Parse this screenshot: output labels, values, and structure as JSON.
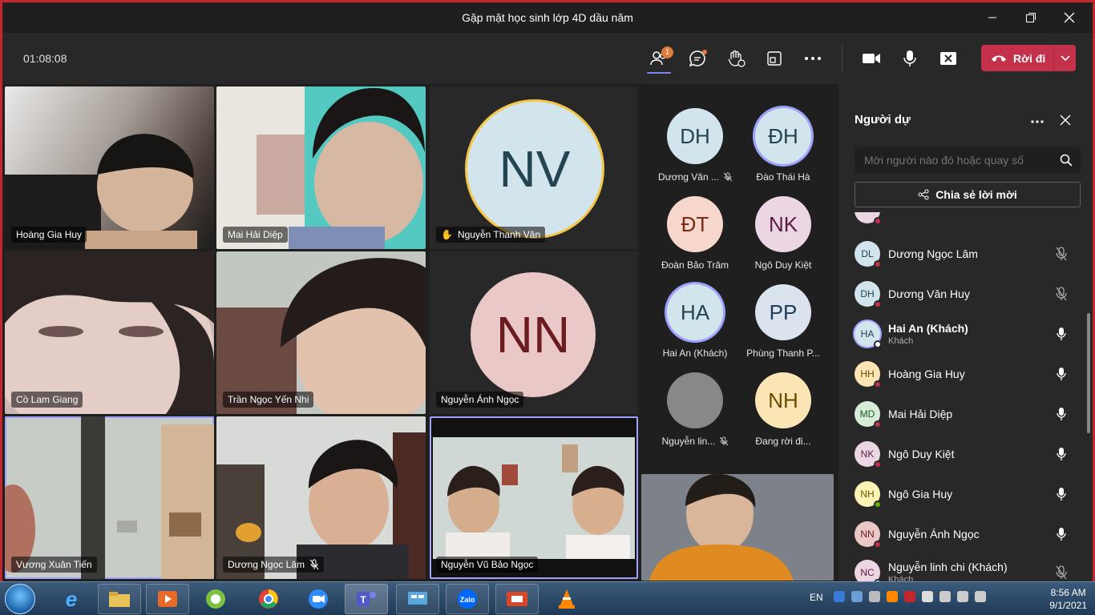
{
  "window": {
    "title": "Gặp mặt học sinh lớp 4D dầu năm"
  },
  "toolbar": {
    "timer": "01:08:08",
    "participants_badge": "1",
    "leave_label": "Rời đi"
  },
  "colors": {
    "accent": "#7f85f5",
    "leave": "#c4314b",
    "border": "#c4262e"
  },
  "tiles": [
    {
      "name": "Hoàng Gia Huy"
    },
    {
      "name": "Mai Hải Diệp"
    },
    {
      "name": "Nguyễn Thanh Vân",
      "initials": "NV"
    },
    {
      "name": "Cồ Lam Giang"
    },
    {
      "name": "Trần Ngọc Yến Nhi"
    },
    {
      "name": "Nguyễn Ánh Ngọc",
      "initials": "NN"
    },
    {
      "name": "Vương Xuân Tiến"
    },
    {
      "name": "Dương Ngọc Lâm"
    },
    {
      "name": "Nguyễn Vũ Bảo Ngọc"
    }
  ],
  "strip": [
    {
      "initials": "DH",
      "label": "Dương Văn ..."
    },
    {
      "initials": "ĐH",
      "label": "Đào Thái Hà"
    },
    {
      "initials": "ĐT",
      "label": "Đoàn Bảo Trâm"
    },
    {
      "initials": "NK",
      "label": "Ngô Duy Kiệt"
    },
    {
      "initials": "HA",
      "label": "Hai An (Khách)"
    },
    {
      "initials": "PP",
      "label": "Phùng Thanh P..."
    },
    {
      "initials": "",
      "label": "Nguyễn lin..."
    },
    {
      "initials": "NH",
      "label": "Đang rời đi..."
    }
  ],
  "panel": {
    "title": "Người dự",
    "search_placeholder": "Mời người nào đó hoặc quay số",
    "share_label": "Chia sẻ lời mời",
    "people": [
      {
        "initials": "DL",
        "name": "Dương Ngọc Lâm",
        "sub": ""
      },
      {
        "initials": "DH",
        "name": "Dương Văn Huy",
        "sub": ""
      },
      {
        "initials": "HA",
        "name": "Hai An (Khách)",
        "sub": "Khách"
      },
      {
        "initials": "HH",
        "name": "Hoàng Gia Huy",
        "sub": ""
      },
      {
        "initials": "MD",
        "name": "Mai Hải Diệp",
        "sub": ""
      },
      {
        "initials": "NK",
        "name": "Ngô Duy Kiệt",
        "sub": ""
      },
      {
        "initials": "NH",
        "name": "Ngô Gia Huy",
        "sub": ""
      },
      {
        "initials": "NN",
        "name": "Nguyễn Ánh Ngọc",
        "sub": ""
      },
      {
        "initials": "NC",
        "name": "Nguyễn linh chi (Khách)",
        "sub": "Khách"
      }
    ]
  },
  "taskbar": {
    "apps": [
      "internet-explorer",
      "file-explorer",
      "media-player",
      "coccoc-browser",
      "chrome",
      "zoom",
      "teams",
      "control-panel",
      "zalo",
      "slideshow",
      "vlc"
    ],
    "language": "EN",
    "time": "8:56 AM",
    "date": "9/1/2021"
  }
}
